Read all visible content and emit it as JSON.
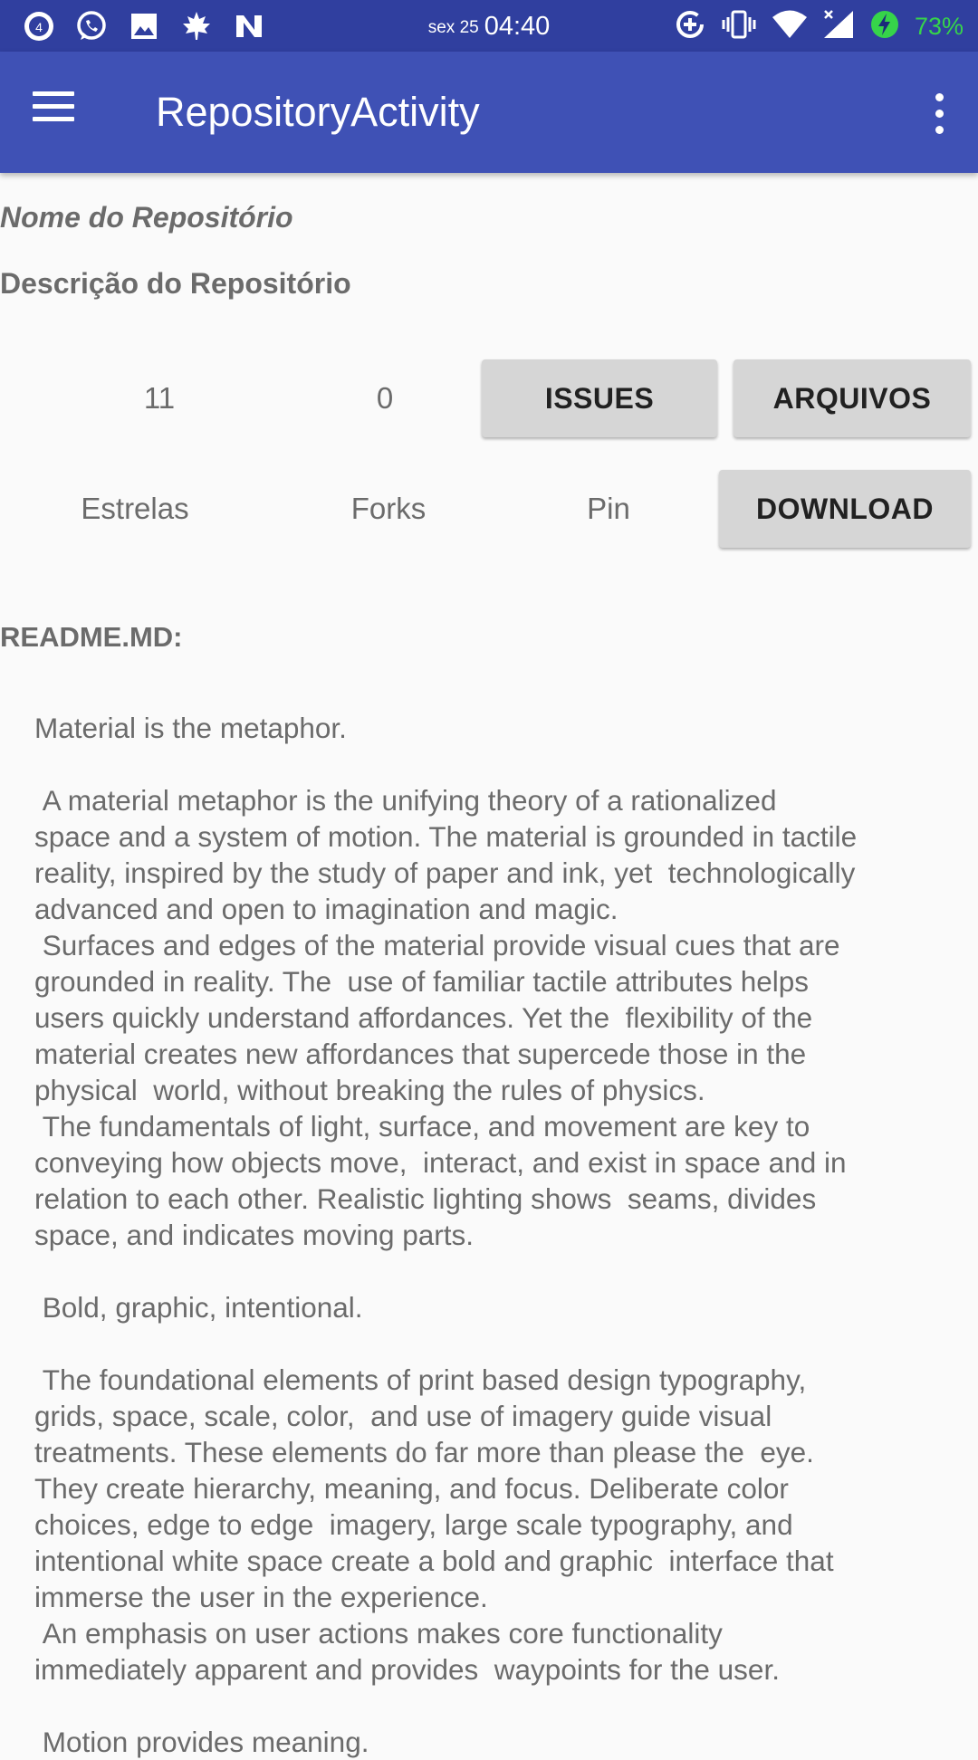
{
  "status_bar": {
    "icons_left": [
      "notification-count-icon",
      "whatsapp-icon",
      "image-icon",
      "leaf-icon",
      "n-icon"
    ],
    "notification_count": "4",
    "day": "sex 25",
    "time": "04:40",
    "icons_right": [
      "data-saver-icon",
      "vibrate-icon",
      "wifi-icon",
      "no-signal-icon",
      "battery-charging-icon"
    ],
    "battery": "73%"
  },
  "app_bar": {
    "title": "RepositoryActivity",
    "background": "#3f51b5",
    "status_color": "#303f9f"
  },
  "repo": {
    "name": "Nome do Repositório",
    "description": "Descrição do Repositório"
  },
  "stats": {
    "stars_value": "11",
    "forks_value": "0",
    "stars_label": "Estrelas",
    "forks_label": "Forks",
    "pin_label": "Pin"
  },
  "buttons": {
    "issues": "ISSUES",
    "arquivos": "ARQUIVOS",
    "download": "DOWNLOAD"
  },
  "readme": {
    "label": "README.MD:",
    "lines": [
      "Material is the metaphor.",
      "",
      " A material metaphor is the unifying theory of a rationalized",
      "space and a system of motion. The material is grounded in tactile",
      "reality, inspired by the study of paper and ink, yet  technologically",
      "advanced and open to imagination and magic.",
      " Surfaces and edges of the material provide visual cues that are",
      "grounded in reality. The  use of familiar tactile attributes helps",
      "users quickly understand affordances. Yet the  flexibility of the",
      "material creates new affordances that supercede those in the",
      "physical  world, without breaking the rules of physics.",
      " The fundamentals of light, surface, and movement are key to",
      "conveying how objects move,  interact, and exist in space and in",
      "relation to each other. Realistic lighting shows  seams, divides",
      "space, and indicates moving parts.",
      "",
      " Bold, graphic, intentional.",
      "",
      " The foundational elements of print based design typography,",
      "grids, space, scale, color,  and use of imagery guide visual",
      "treatments. These elements do far more than please the  eye.",
      "They create hierarchy, meaning, and focus. Deliberate color",
      "choices, edge to edge  imagery, large scale typography, and",
      "intentional white space create a bold and graphic  interface that",
      "immerse the user in the experience.",
      " An emphasis on user actions makes core functionality",
      "immediately apparent and provides  waypoints for the user.",
      "",
      " Motion provides meaning."
    ]
  }
}
